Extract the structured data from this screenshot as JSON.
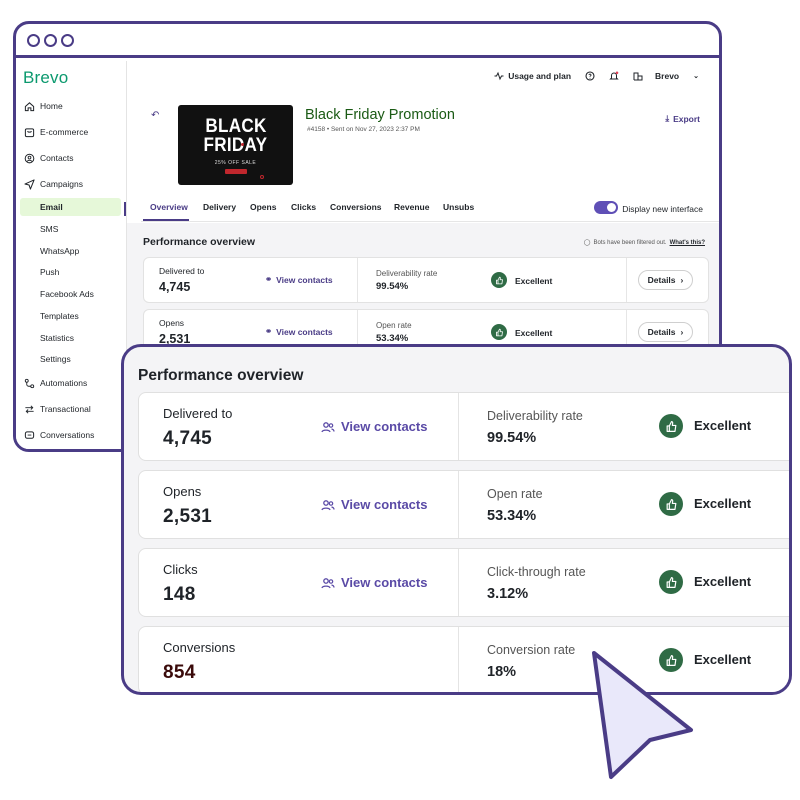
{
  "app": {
    "brand": "Brevo"
  },
  "sidebar": {
    "items": [
      {
        "label": "Home",
        "icon": "home-icon"
      },
      {
        "label": "E-commerce",
        "icon": "shop-icon"
      },
      {
        "label": "Contacts",
        "icon": "contacts-icon"
      },
      {
        "label": "Campaigns",
        "icon": "send-icon"
      }
    ],
    "campaign_subitems": [
      "Email",
      "SMS",
      "WhatsApp",
      "Push",
      "Facebook Ads",
      "Templates",
      "Statistics",
      "Settings"
    ],
    "active_subitem": "Email",
    "bottom_items": [
      {
        "label": "Automations",
        "icon": "automation-icon"
      },
      {
        "label": "Transactional",
        "icon": "transactional-icon"
      },
      {
        "label": "Conversations",
        "icon": "chat-icon"
      }
    ]
  },
  "topbar": {
    "usage": "Usage and plan",
    "account": "Brevo"
  },
  "campaign": {
    "title": "Black Friday Promotion",
    "meta": "#4158 • Sent on Nov 27, 2023 2:37 PM",
    "thumbnail": {
      "line1": "BLACK",
      "line2": "FRIDAY",
      "sale": "25% OFF SALE",
      "button": "SHOP NOW"
    },
    "export": "Export"
  },
  "tabs": [
    "Overview",
    "Delivery",
    "Opens",
    "Clicks",
    "Conversions",
    "Revenue",
    "Unsubs"
  ],
  "active_tab": "Overview",
  "toggle": {
    "label": "Display new interface",
    "on": true
  },
  "performance": {
    "title": "Performance overview",
    "bots_note": "Bots have been filtered out.",
    "whats_this": "What's this?",
    "view_contacts": "View contacts",
    "details": "Details",
    "rows": [
      {
        "label": "Delivered to",
        "value": "4,745",
        "rate_label": "Deliverability rate",
        "rate_value": "99.54%",
        "status": "Excellent"
      },
      {
        "label": "Opens",
        "value": "2,531",
        "rate_label": "Open rate",
        "rate_value": "53.34%",
        "status": "Excellent"
      },
      {
        "label": "Clicks",
        "value": "148",
        "rate_label": "Click-through rate",
        "rate_value": "3.12%",
        "status": "Excellent"
      },
      {
        "label": "Conversions",
        "value": "854",
        "rate_label": "Conversion rate",
        "rate_value": "18%",
        "status": "Excellent"
      }
    ]
  },
  "colors": {
    "frame": "#4a3c86",
    "brand": "#0b996e",
    "accent": "#5a4aa6",
    "status_green": "#2f6b45",
    "active_nav_bg": "#e6f8d9"
  }
}
